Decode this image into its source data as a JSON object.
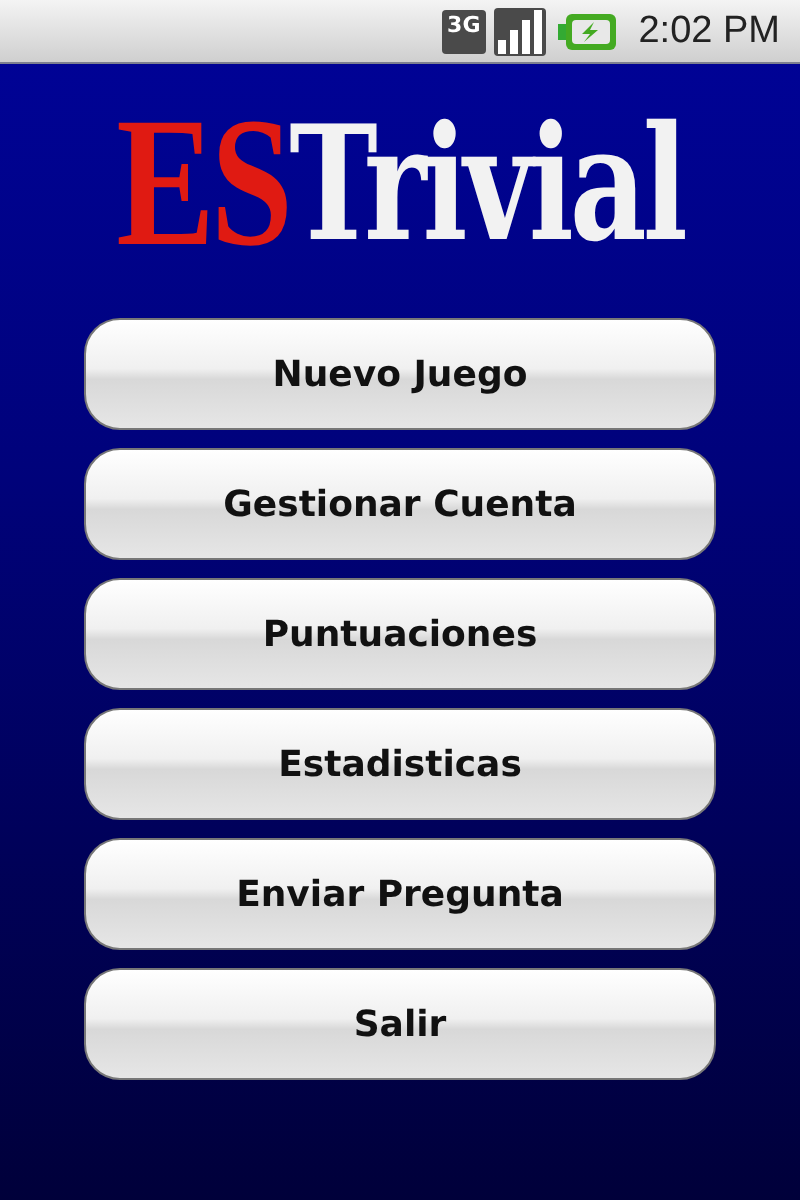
{
  "status_bar": {
    "network_type": "3G",
    "time": "2:02 PM"
  },
  "logo": {
    "parts": [
      {
        "text": "ES",
        "kind": "accent"
      },
      {
        "text": "Trivial",
        "kind": "plain"
      }
    ]
  },
  "menu": [
    {
      "label": "Nuevo Juego"
    },
    {
      "label": "Gestionar Cuenta"
    },
    {
      "label": "Puntuaciones"
    },
    {
      "label": "Estadisticas"
    },
    {
      "label": "Enviar Pregunta"
    },
    {
      "label": "Salir"
    }
  ]
}
